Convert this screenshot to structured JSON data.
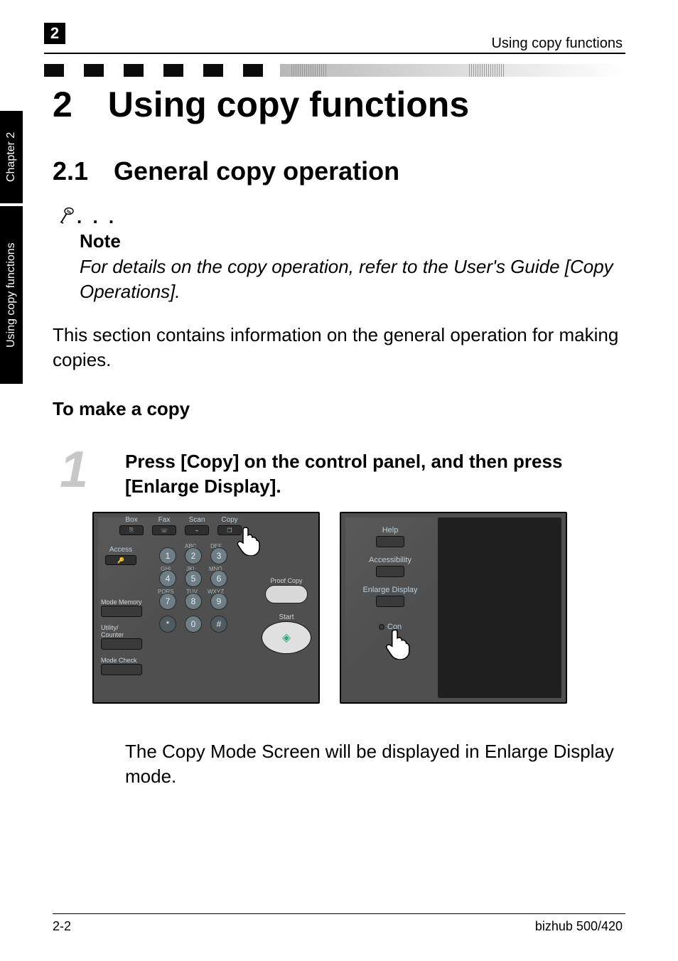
{
  "header": {
    "chapter_number": "2",
    "running_title": "Using copy functions"
  },
  "sidebar": {
    "chapter_label": "Chapter 2",
    "section_label": "Using copy functions"
  },
  "titles": {
    "chapter": "2 Using copy functions",
    "section": "2.1 General copy operation"
  },
  "note": {
    "dots": ". . .",
    "label": "Note",
    "body": "For details on the copy operation, refer to the User's Guide [Copy Operations]."
  },
  "intro_paragraph": "This section contains information on the general operation for making copies.",
  "step_heading": "To make a copy",
  "step1": {
    "number": "1",
    "text": "Press [Copy] on the control panel, and then press [Enlarge Display]."
  },
  "panel1": {
    "tabs": {
      "box": "Box",
      "fax": "Fax",
      "scan": "Scan",
      "copy": "Copy"
    },
    "access_label": "Access",
    "keypad_labels": {
      "abc": "ABC",
      "def": "DEF",
      "ghi": "GHI",
      "jkl": "JKL",
      "mno": "MNO",
      "pqrs": "PQRS",
      "tuv": "TUV",
      "wxyz": "WXYZ"
    },
    "keys": [
      "1",
      "2",
      "3",
      "4",
      "5",
      "6",
      "7",
      "8",
      "9",
      "*",
      "0",
      "#"
    ],
    "proof_copy": "Proof Copy",
    "start": "Start",
    "mode_memory": "Mode Memory",
    "utility_counter": "Utility/\nCounter",
    "mode_check": "Mode Check"
  },
  "panel2": {
    "help": "Help",
    "accessibility": "Accessibility",
    "enlarge_display": "Enlarge Display",
    "con": "Con"
  },
  "outcome_text": "The Copy Mode Screen will be displayed in Enlarge Display mode.",
  "footer": {
    "page": "2-2",
    "model": "bizhub 500/420"
  }
}
